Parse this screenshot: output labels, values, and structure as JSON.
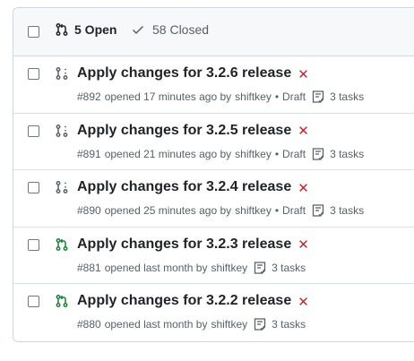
{
  "header": {
    "open_label": "5 Open",
    "closed_label": "58 Closed"
  },
  "pulls": [
    {
      "title": "Apply changes for 3.2.6 release",
      "status": "draft",
      "number": "#892",
      "opened": "opened 17 minutes ago by",
      "author": "shiftkey",
      "draft_label": "Draft",
      "tasks": "3 tasks",
      "status_icon": "x-icon"
    },
    {
      "title": "Apply changes for 3.2.5 release",
      "status": "draft",
      "number": "#891",
      "opened": "opened 21 minutes ago by",
      "author": "shiftkey",
      "draft_label": "Draft",
      "tasks": "3 tasks",
      "status_icon": "x-icon"
    },
    {
      "title": "Apply changes for 3.2.4 release",
      "status": "draft",
      "number": "#890",
      "opened": "opened 25 minutes ago by",
      "author": "shiftkey",
      "draft_label": "Draft",
      "tasks": "3 tasks",
      "status_icon": "x-icon"
    },
    {
      "title": "Apply changes for 3.2.3 release",
      "status": "open",
      "number": "#881",
      "opened": "opened last month by",
      "author": "shiftkey",
      "draft_label": "",
      "tasks": "3 tasks",
      "status_icon": "x-icon"
    },
    {
      "title": "Apply changes for 3.2.2 release",
      "status": "open",
      "number": "#880",
      "opened": "opened last month by",
      "author": "shiftkey",
      "draft_label": "",
      "tasks": "3 tasks",
      "status_icon": "x-icon"
    }
  ],
  "colors": {
    "open_green": "#1a7f37",
    "draft_gray": "#57606a",
    "fail_red": "#cf222e"
  }
}
